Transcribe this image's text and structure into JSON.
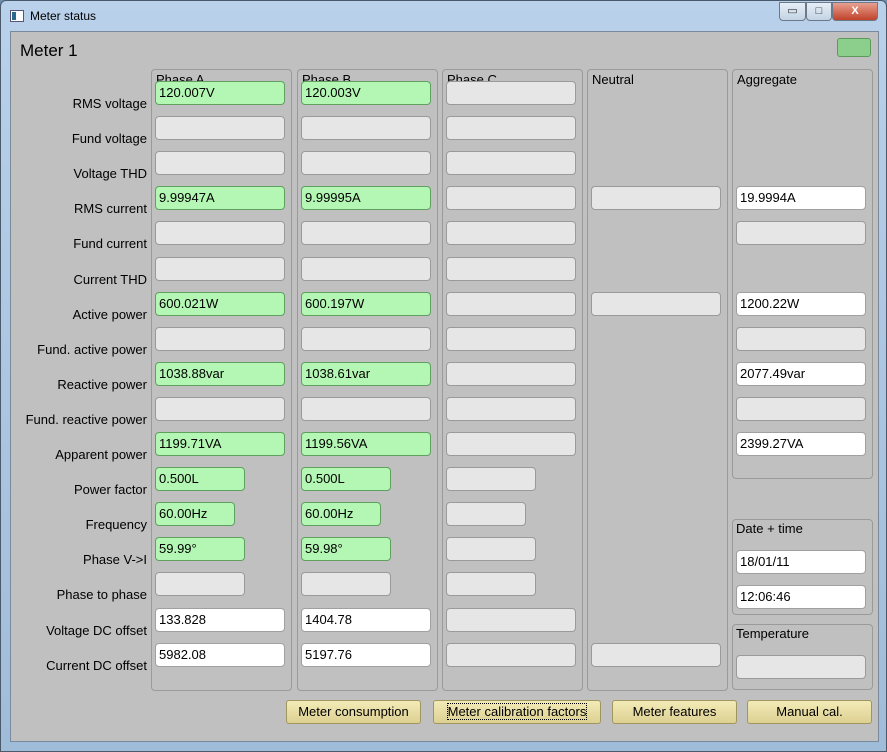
{
  "window": {
    "title": "Meter status",
    "minimize": "▭",
    "maximize": "□",
    "close": "X"
  },
  "meter_title": "Meter 1",
  "colors": {
    "ok_field": "#b4f7b4",
    "empty_field": "#e6e6e6",
    "status_led": "#8ccf8c",
    "button": "#e8dca4"
  },
  "rows": [
    "RMS voltage",
    "Fund voltage",
    "Voltage THD",
    "RMS current",
    "Fund current",
    "Current THD",
    "Active power",
    "Fund. active power",
    "Reactive power",
    "Fund. reactive power",
    "Apparent power",
    "Power factor",
    "Frequency",
    "Phase V->I",
    "Phase to phase",
    "Voltage DC offset",
    "Current DC offset"
  ],
  "columns": {
    "phase_a": {
      "title": "Phase A",
      "values": [
        "120.007V",
        "",
        "",
        "9.99947A",
        "",
        "",
        "600.021W",
        "",
        "1038.88var",
        "",
        "1199.71VA",
        "0.500L",
        "60.00Hz",
        "59.99°",
        "",
        "133.828",
        "5982.08"
      ]
    },
    "phase_b": {
      "title": "Phase B",
      "values": [
        "120.003V",
        "",
        "",
        "9.99995A",
        "",
        "",
        "600.197W",
        "",
        "1038.61var",
        "",
        "1199.56VA",
        "0.500L",
        "60.00Hz",
        "59.98°",
        "",
        "1404.78",
        "5197.76"
      ]
    },
    "phase_c": {
      "title": "Phase C",
      "values": [
        "",
        "",
        "",
        "",
        "",
        "",
        "",
        "",
        "",
        "",
        "",
        "",
        "",
        "",
        "",
        "",
        ""
      ]
    },
    "neutral": {
      "title": "Neutral",
      "values": {
        "3": "",
        "6": "",
        "16": ""
      }
    },
    "aggregate": {
      "title": "Aggregate",
      "values": {
        "3": "19.9994A",
        "4": "",
        "6": "1200.22W",
        "7": "",
        "8": "2077.49var",
        "9": "",
        "10": "2399.27VA"
      }
    }
  },
  "date_time": {
    "title": "Date + time",
    "date": "18/01/11",
    "time": "12:06:46"
  },
  "temperature": {
    "title": "Temperature",
    "value": ""
  },
  "buttons": [
    "Meter consumption",
    "Meter calibration factors",
    "Meter features",
    "Manual cal."
  ]
}
